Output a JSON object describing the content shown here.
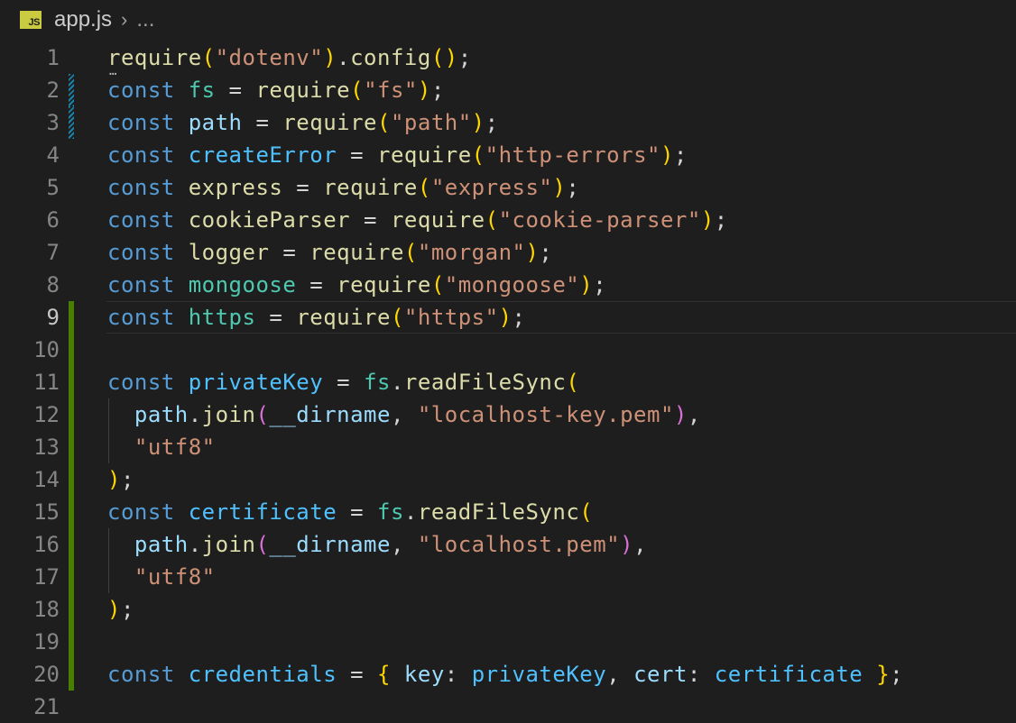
{
  "breadcrumb": {
    "file_icon": "JS",
    "file_name": "app.js",
    "chevron": "›",
    "ellipsis": "..."
  },
  "editor": {
    "current_line": 9,
    "lines": [
      {
        "n": "1",
        "gutter": "none",
        "tokens": [
          [
            "fn",
            "require"
          ],
          [
            "p1",
            "("
          ],
          [
            "str",
            "\"dotenv\""
          ],
          [
            "p1",
            ")"
          ],
          [
            "pl",
            "."
          ],
          [
            "fn",
            "config"
          ],
          [
            "p1",
            "()"
          ],
          [
            "pl",
            ";"
          ]
        ]
      },
      {
        "n": "2",
        "gutter": "modified",
        "tokens": [
          [
            "kw",
            "const"
          ],
          [
            "pl",
            " "
          ],
          [
            "mod",
            "fs"
          ],
          [
            "pl",
            " = "
          ],
          [
            "fn",
            "require"
          ],
          [
            "p1",
            "("
          ],
          [
            "str",
            "\"fs\""
          ],
          [
            "p1",
            ")"
          ],
          [
            "pl",
            ";"
          ]
        ]
      },
      {
        "n": "3",
        "gutter": "modified",
        "tokens": [
          [
            "kw",
            "const"
          ],
          [
            "pl",
            " "
          ],
          [
            "var",
            "path"
          ],
          [
            "pl",
            " = "
          ],
          [
            "fn",
            "require"
          ],
          [
            "p1",
            "("
          ],
          [
            "str",
            "\"path\""
          ],
          [
            "p1",
            ")"
          ],
          [
            "pl",
            ";"
          ]
        ]
      },
      {
        "n": "4",
        "gutter": "none",
        "tokens": [
          [
            "kw",
            "const"
          ],
          [
            "pl",
            " "
          ],
          [
            "cst",
            "createError"
          ],
          [
            "pl",
            " = "
          ],
          [
            "fn",
            "require"
          ],
          [
            "p1",
            "("
          ],
          [
            "str",
            "\"http-errors\""
          ],
          [
            "p1",
            ")"
          ],
          [
            "pl",
            ";"
          ]
        ]
      },
      {
        "n": "5",
        "gutter": "none",
        "tokens": [
          [
            "kw",
            "const"
          ],
          [
            "pl",
            " "
          ],
          [
            "fn",
            "express"
          ],
          [
            "pl",
            " = "
          ],
          [
            "fn",
            "require"
          ],
          [
            "p1",
            "("
          ],
          [
            "str",
            "\"express\""
          ],
          [
            "p1",
            ")"
          ],
          [
            "pl",
            ";"
          ]
        ]
      },
      {
        "n": "6",
        "gutter": "none",
        "tokens": [
          [
            "kw",
            "const"
          ],
          [
            "pl",
            " "
          ],
          [
            "fn",
            "cookieParser"
          ],
          [
            "pl",
            " = "
          ],
          [
            "fn",
            "require"
          ],
          [
            "p1",
            "("
          ],
          [
            "str",
            "\"cookie-parser\""
          ],
          [
            "p1",
            ")"
          ],
          [
            "pl",
            ";"
          ]
        ]
      },
      {
        "n": "7",
        "gutter": "none",
        "tokens": [
          [
            "kw",
            "const"
          ],
          [
            "pl",
            " "
          ],
          [
            "fn",
            "logger"
          ],
          [
            "pl",
            " = "
          ],
          [
            "fn",
            "require"
          ],
          [
            "p1",
            "("
          ],
          [
            "str",
            "\"morgan\""
          ],
          [
            "p1",
            ")"
          ],
          [
            "pl",
            ";"
          ]
        ]
      },
      {
        "n": "8",
        "gutter": "none",
        "tokens": [
          [
            "kw",
            "const"
          ],
          [
            "pl",
            " "
          ],
          [
            "mod",
            "mongoose"
          ],
          [
            "pl",
            " = "
          ],
          [
            "fn",
            "require"
          ],
          [
            "p1",
            "("
          ],
          [
            "str",
            "\"mongoose\""
          ],
          [
            "p1",
            ")"
          ],
          [
            "pl",
            ";"
          ]
        ]
      },
      {
        "n": "9",
        "gutter": "added",
        "tokens": [
          [
            "kw",
            "const"
          ],
          [
            "pl",
            " "
          ],
          [
            "mod",
            "https"
          ],
          [
            "pl",
            " = "
          ],
          [
            "fn",
            "require"
          ],
          [
            "p1",
            "("
          ],
          [
            "str",
            "\"https\""
          ],
          [
            "p1",
            ")"
          ],
          [
            "pl",
            ";"
          ]
        ]
      },
      {
        "n": "10",
        "gutter": "added",
        "tokens": []
      },
      {
        "n": "11",
        "gutter": "added",
        "tokens": [
          [
            "kw",
            "const"
          ],
          [
            "pl",
            " "
          ],
          [
            "cst",
            "privateKey"
          ],
          [
            "pl",
            " = "
          ],
          [
            "mod",
            "fs"
          ],
          [
            "pl",
            "."
          ],
          [
            "fn",
            "readFileSync"
          ],
          [
            "p1",
            "("
          ]
        ]
      },
      {
        "n": "12",
        "gutter": "added",
        "indent": true,
        "tokens": [
          [
            "pl",
            "  "
          ],
          [
            "var",
            "path"
          ],
          [
            "pl",
            "."
          ],
          [
            "fn",
            "join"
          ],
          [
            "p2",
            "("
          ],
          [
            "var",
            "__dirname"
          ],
          [
            "pl",
            ", "
          ],
          [
            "str",
            "\"localhost-key.pem\""
          ],
          [
            "p2",
            ")"
          ],
          [
            "pl",
            ","
          ]
        ]
      },
      {
        "n": "13",
        "gutter": "added",
        "indent": true,
        "tokens": [
          [
            "pl",
            "  "
          ],
          [
            "str",
            "\"utf8\""
          ]
        ]
      },
      {
        "n": "14",
        "gutter": "added",
        "tokens": [
          [
            "p1",
            ")"
          ],
          [
            "pl",
            ";"
          ]
        ]
      },
      {
        "n": "15",
        "gutter": "added",
        "tokens": [
          [
            "kw",
            "const"
          ],
          [
            "pl",
            " "
          ],
          [
            "cst",
            "certificate"
          ],
          [
            "pl",
            " = "
          ],
          [
            "mod",
            "fs"
          ],
          [
            "pl",
            "."
          ],
          [
            "fn",
            "readFileSync"
          ],
          [
            "p1",
            "("
          ]
        ]
      },
      {
        "n": "16",
        "gutter": "added",
        "indent": true,
        "tokens": [
          [
            "pl",
            "  "
          ],
          [
            "var",
            "path"
          ],
          [
            "pl",
            "."
          ],
          [
            "fn",
            "join"
          ],
          [
            "p2",
            "("
          ],
          [
            "var",
            "__dirname"
          ],
          [
            "pl",
            ", "
          ],
          [
            "str",
            "\"localhost.pem\""
          ],
          [
            "p2",
            ")"
          ],
          [
            "pl",
            ","
          ]
        ]
      },
      {
        "n": "17",
        "gutter": "added",
        "indent": true,
        "tokens": [
          [
            "pl",
            "  "
          ],
          [
            "str",
            "\"utf8\""
          ]
        ]
      },
      {
        "n": "18",
        "gutter": "added",
        "tokens": [
          [
            "p1",
            ")"
          ],
          [
            "pl",
            ";"
          ]
        ]
      },
      {
        "n": "19",
        "gutter": "added",
        "tokens": []
      },
      {
        "n": "20",
        "gutter": "added",
        "tokens": [
          [
            "kw",
            "const"
          ],
          [
            "pl",
            " "
          ],
          [
            "cst",
            "credentials"
          ],
          [
            "pl",
            " = "
          ],
          [
            "p1",
            "{"
          ],
          [
            "pl",
            " "
          ],
          [
            "var",
            "key"
          ],
          [
            "pl",
            ": "
          ],
          [
            "cst",
            "privateKey"
          ],
          [
            "pl",
            ", "
          ],
          [
            "var",
            "cert"
          ],
          [
            "pl",
            ": "
          ],
          [
            "cst",
            "certificate"
          ],
          [
            "pl",
            " "
          ],
          [
            "p1",
            "}"
          ],
          [
            "pl",
            ";"
          ]
        ]
      },
      {
        "n": "21",
        "gutter": "none",
        "tokens": []
      }
    ]
  }
}
